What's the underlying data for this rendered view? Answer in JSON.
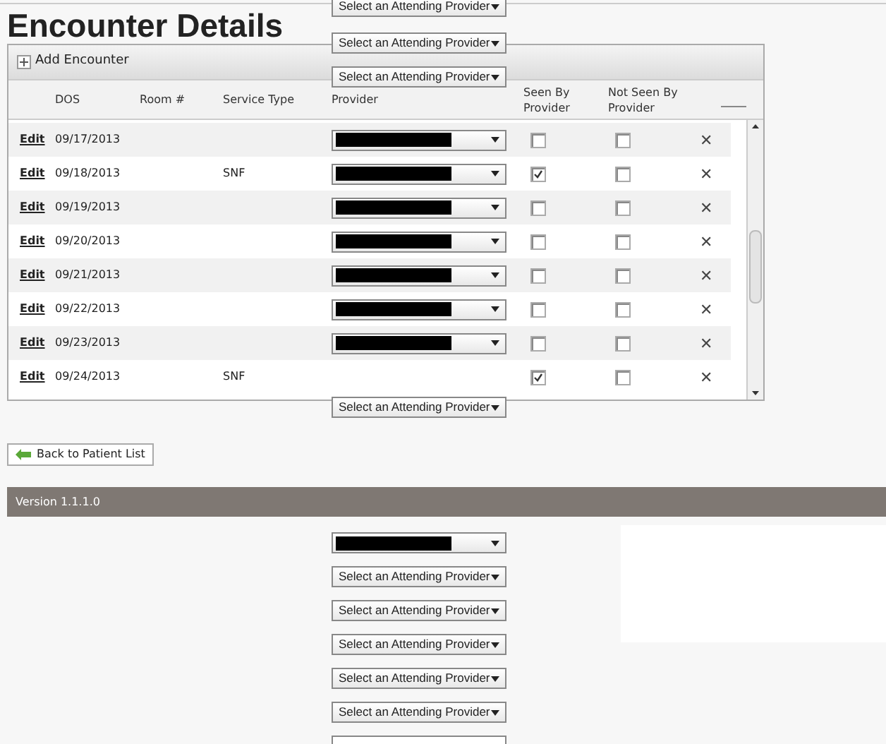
{
  "title": "Encounter Details",
  "toolbar": {
    "add_button": "Add Encounter"
  },
  "table": {
    "columns": [
      "DOS",
      "Room #",
      "Service Type",
      "Provider",
      "Seen By Provider",
      "Not Seen By Provider"
    ],
    "rows": [
      {
        "edit": "Edit",
        "dos": "09/17/2013",
        "service_type": null,
        "provider_dropdown": {
          "kind": "redacted"
        },
        "seen": false,
        "not_seen": false,
        "delete": "✕"
      },
      {
        "edit": "Edit",
        "dos": "09/18/2013",
        "service_type": "SNF",
        "provider_dropdown": {
          "kind": "redacted"
        },
        "seen": true,
        "not_seen": false,
        "delete": "✕"
      },
      {
        "edit": "Edit",
        "dos": "09/19/2013",
        "service_type": null,
        "provider_dropdown": {
          "kind": "redacted"
        },
        "seen": false,
        "not_seen": false,
        "delete": "✕"
      },
      {
        "edit": "Edit",
        "dos": "09/20/2013",
        "service_type": null,
        "provider_dropdown": {
          "kind": "redacted"
        },
        "seen": false,
        "not_seen": false,
        "delete": "✕"
      },
      {
        "edit": "Edit",
        "dos": "09/21/2013",
        "service_type": null,
        "provider_dropdown": {
          "kind": "redacted"
        },
        "seen": false,
        "not_seen": false,
        "delete": "✕"
      },
      {
        "edit": "Edit",
        "dos": "09/22/2013",
        "service_type": null,
        "provider_dropdown": {
          "kind": "redacted"
        },
        "seen": false,
        "not_seen": false,
        "delete": "✕"
      },
      {
        "edit": "Edit",
        "dos": "09/23/2013",
        "service_type": null,
        "provider_dropdown": {
          "kind": "redacted"
        },
        "seen": false,
        "not_seen": false,
        "delete": "✕"
      },
      {
        "edit": "Edit",
        "dos": "09/24/2013",
        "service_type": "SNF",
        "provider_dropdown": null,
        "seen": true,
        "not_seen": false,
        "delete": "✕"
      }
    ]
  },
  "back_button": "Back to Patient List",
  "footer": {
    "version": "Version 1.1.1.0"
  },
  "floating_dropdowns": [
    {
      "kind": "placeholder",
      "text": "Select an Attending Provider"
    },
    {
      "kind": "placeholder",
      "text": "Select an Attending Provider"
    },
    {
      "kind": "placeholder",
      "text": "Select an Attending Provider"
    },
    {
      "kind": "placeholder",
      "text": "Select an Attending Provider"
    },
    {
      "kind": "redacted"
    },
    {
      "kind": "placeholder",
      "text": "Select an Attending Provider"
    },
    {
      "kind": "placeholder",
      "text": "Select an Attending Provider"
    },
    {
      "kind": "placeholder",
      "text": "Select an Attending Provider"
    },
    {
      "kind": "placeholder",
      "text": "Select an Attending Provider"
    },
    {
      "kind": "placeholder",
      "text": "Select an Attending Provider"
    },
    {
      "kind": "cut"
    }
  ]
}
